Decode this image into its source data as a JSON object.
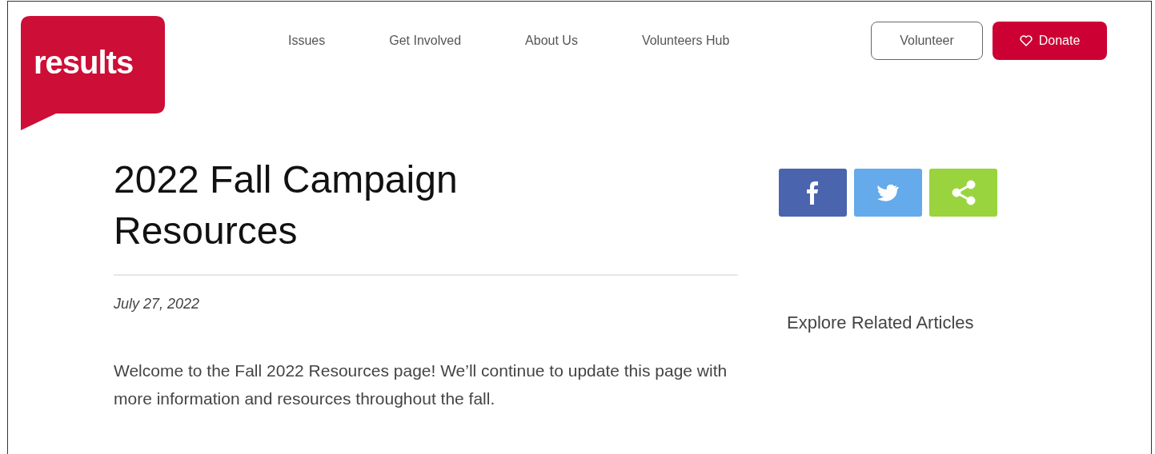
{
  "logo": {
    "text": "results"
  },
  "nav": {
    "items": [
      "Issues",
      "Get Involved",
      "About Us",
      "Volunteers Hub"
    ]
  },
  "header_buttons": [
    {
      "kind": "outline",
      "label": "Volunteer"
    },
    {
      "kind": "donate",
      "label": "Donate"
    }
  ],
  "article": {
    "title": "2022 Fall Campaign Resources",
    "date": "July 27, 2022",
    "intro": "Welcome to the Fall 2022 Resources page! We’ll continue to update this page with more information and resources throughout the fall."
  },
  "share_buttons": [
    {
      "kind": "facebook"
    },
    {
      "kind": "twitter"
    },
    {
      "kind": "share"
    }
  ],
  "sidebar": {
    "heading": "Explore Related Articles"
  }
}
